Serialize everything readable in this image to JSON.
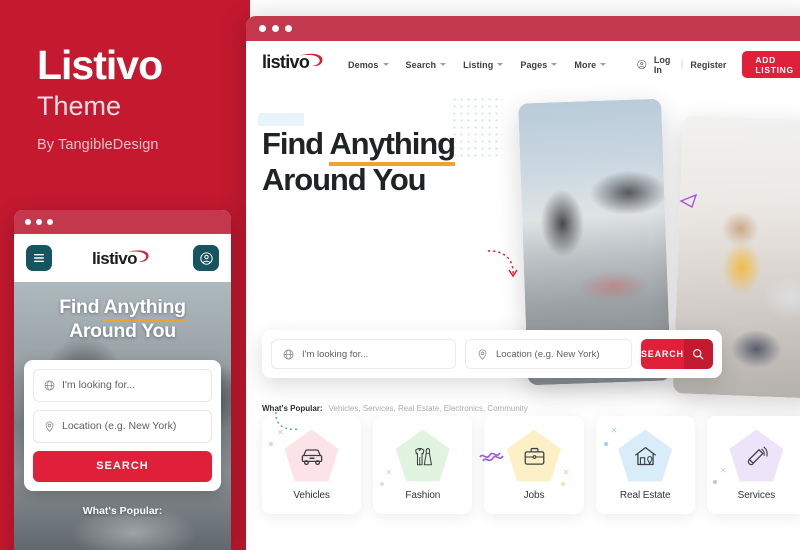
{
  "left_panel": {
    "brand_name": "Listivo",
    "brand_type": "Theme",
    "author": "By TangibleDesign",
    "bg_color": "#c4192f"
  },
  "mobile_mockup": {
    "titlebar_dots": 3,
    "menu_icon": "hamburger-icon",
    "logo_text": "listivo",
    "account_icon": "user-circle-icon",
    "hero_title_line1_pre": "Find ",
    "hero_title_line1_mark": "Anything",
    "hero_title_line2": "Around You",
    "search_placeholder": "I'm looking for...",
    "location_placeholder": "Location (e.g. New York)",
    "search_button": "SEARCH",
    "popular_label": "What's Popular:"
  },
  "desktop_mockup": {
    "titlebar_dots": 3,
    "logo_text": "listivo",
    "nav_items": [
      {
        "label": "Demos",
        "has_dropdown": true
      },
      {
        "label": "Search",
        "has_dropdown": true
      },
      {
        "label": "Listing",
        "has_dropdown": true
      },
      {
        "label": "Pages",
        "has_dropdown": true
      },
      {
        "label": "More",
        "has_dropdown": true
      }
    ],
    "auth": {
      "icon": "user-circle-icon",
      "login": "Log In",
      "separator": "|",
      "register": "Register"
    },
    "add_listing": {
      "label": "ADD LISTING",
      "plus": "+"
    },
    "hero": {
      "title_line1_pre": "Find ",
      "title_line1_mark": "Anything",
      "title_line2": "Around You",
      "search_placeholder": "I'm looking for...",
      "search_icon": "globe-icon",
      "location_placeholder": "Location (e.g. New York)",
      "location_icon": "map-pin-icon",
      "search_button": "SEARCH",
      "search_button_icon": "magnifier-icon",
      "popular_label": "What's Popular:",
      "popular_links": "Vehicles, Services, Real Estate, Electronics, Community"
    },
    "categories": [
      {
        "label": "Vehicles",
        "icon": "car-icon",
        "blob_color": "#fbe3e8"
      },
      {
        "label": "Fashion",
        "icon": "clothes-icon",
        "blob_color": "#e0f4df"
      },
      {
        "label": "Jobs",
        "icon": "briefcase-icon",
        "blob_color": "#fdf0c7"
      },
      {
        "label": "Real Estate",
        "icon": "house-icon",
        "blob_color": "#d8ecfa"
      },
      {
        "label": "Services",
        "icon": "megaphone-icon",
        "blob_color": "#eee4fa"
      }
    ]
  },
  "colors": {
    "brand_red": "#c4192f",
    "accent_red": "#e01f38",
    "titlebar_red": "#c4384d",
    "underline_orange": "#f0a22e",
    "dark_teal": "#16545f"
  }
}
